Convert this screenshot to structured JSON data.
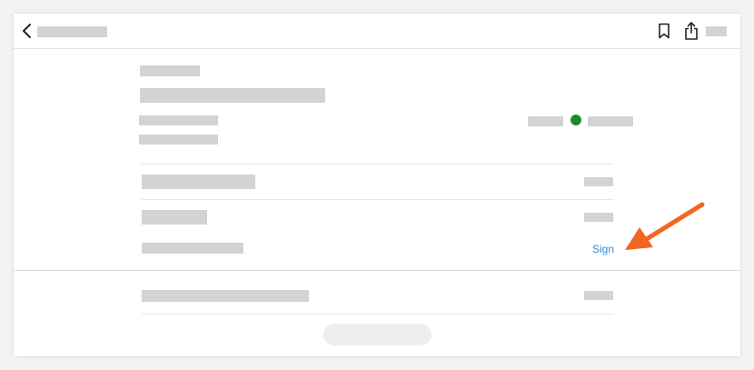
{
  "header": {
    "back_icon": "chevron-left-icon",
    "bookmark_icon": "bookmark-icon",
    "share_icon": "share-icon"
  },
  "row_action": {
    "label": "Sign"
  },
  "status": {
    "dot_color": "#1e8a27"
  },
  "annotation": {
    "arrow_color": "#f26522"
  }
}
